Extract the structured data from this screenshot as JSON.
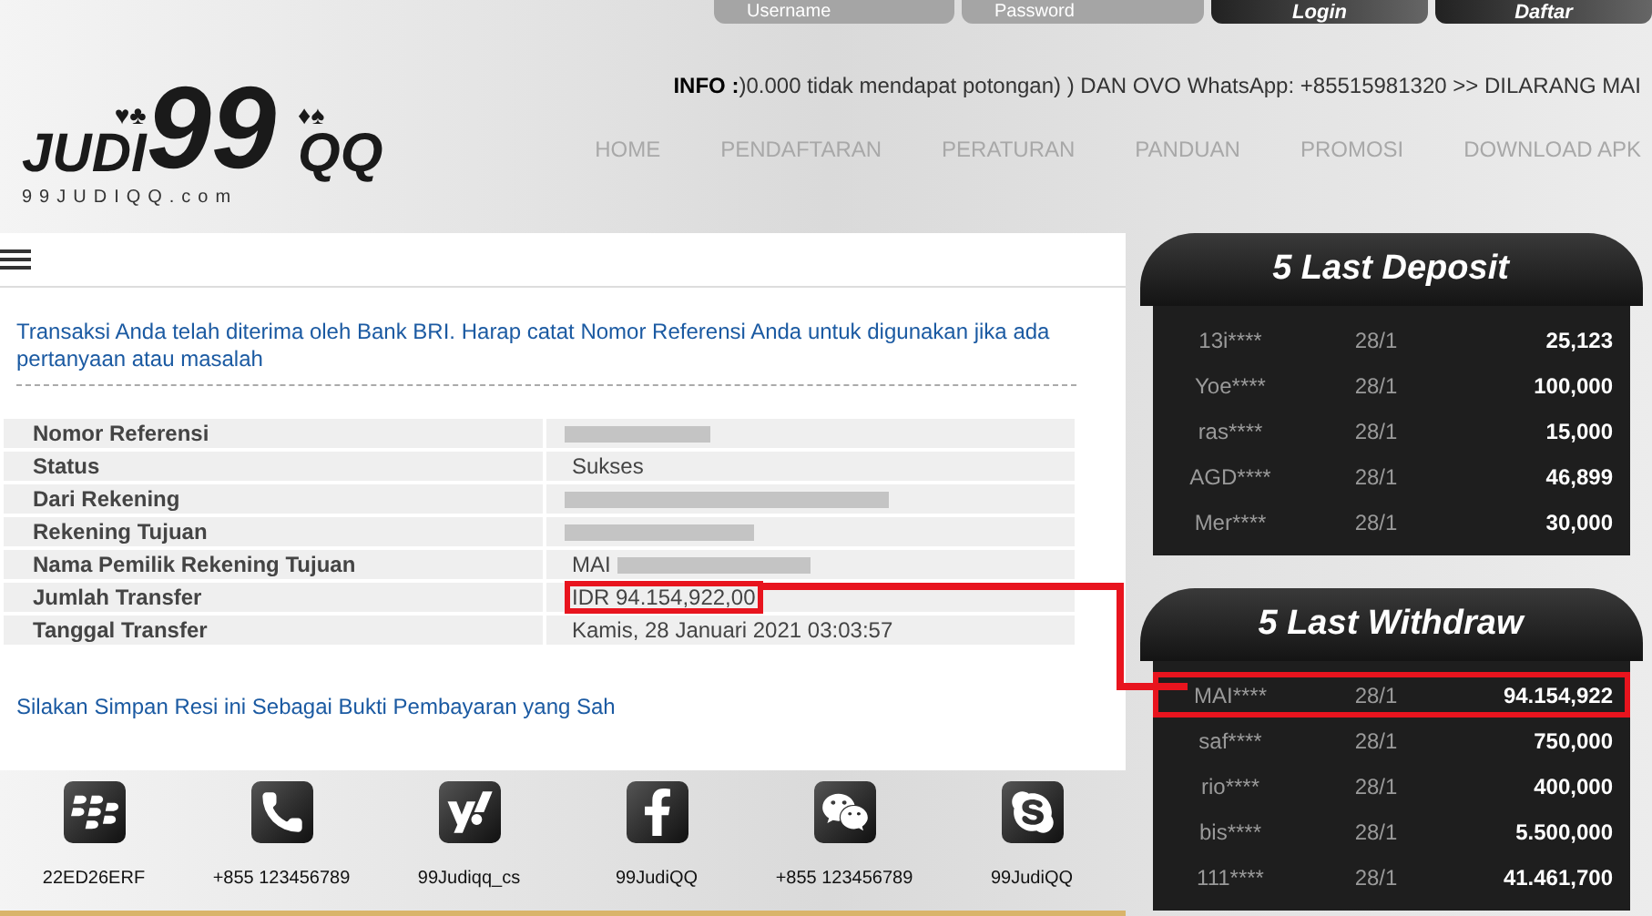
{
  "logo": {
    "numeral": "99",
    "suits_left": "♥♣",
    "suits_right": "♦♠",
    "word_left": "JUDI",
    "word_right": "QQ",
    "domain": "99JUDIQQ.com"
  },
  "login": {
    "username_placeholder": "Username",
    "password_placeholder": "Password",
    "buttons": [
      "Login",
      "Daftar"
    ]
  },
  "info": {
    "label": "INFO :",
    "text": ")0.000 tidak mendapat potongan) ) DAN OVO WhatsApp: +85515981320 >> DILARANG MAI"
  },
  "nav": [
    "HOME",
    "PENDAFTARAN",
    "PERATURAN",
    "PANDUAN",
    "PROMOSI",
    "DOWNLOAD APK"
  ],
  "receipt": {
    "message": "Transaksi Anda telah diterima oleh Bank BRI. Harap catat Nomor Referensi Anda untuk digunakan jika ada pertanyaan atau masalah",
    "rows": [
      {
        "label": "Nomor Referensi",
        "redacted": true
      },
      {
        "label": "Status",
        "value": "Sukses",
        "redacted": false,
        "highlighted": false
      },
      {
        "label": "Dari Rekening",
        "redacted": true
      },
      {
        "label": "Rekening Tujuan",
        "redacted": true
      },
      {
        "label": "Nama Pemilik Rekening Tujuan",
        "value": "MAI",
        "redacted": true,
        "highlighted": false
      },
      {
        "label": "Jumlah Transfer",
        "value": "IDR 94.154,922,00",
        "redacted": false,
        "highlighted": true
      },
      {
        "label": "Tanggal Transfer",
        "value": "Kamis, 28 Januari 2021 03:03:57",
        "redacted": false,
        "highlighted": false
      }
    ],
    "footer_note": "Silakan Simpan Resi ini Sebagai Bukti Pembayaran yang Sah"
  },
  "contacts": [
    {
      "kind": "blackberry",
      "label": "22ED26ERF"
    },
    {
      "kind": "phone",
      "label": "+855 123456789"
    },
    {
      "kind": "yahoo",
      "label": "99Judiqq_cs"
    },
    {
      "kind": "facebook",
      "label": "99JudiQQ"
    },
    {
      "kind": "wechat",
      "label": "+855 123456789"
    },
    {
      "kind": "skype",
      "label": "99JudiQQ"
    }
  ],
  "deposits": {
    "title": "5 Last Deposit",
    "rows": [
      {
        "name": "13i****",
        "date": "28/1",
        "amount": "25,123",
        "highlighted": false
      },
      {
        "name": "Yoe****",
        "date": "28/1",
        "amount": "100,000",
        "highlighted": false
      },
      {
        "name": "ras****",
        "date": "28/1",
        "amount": "15,000",
        "highlighted": false
      },
      {
        "name": "AGD****",
        "date": "28/1",
        "amount": "46,899",
        "highlighted": false
      },
      {
        "name": "Mer****",
        "date": "28/1",
        "amount": "30,000",
        "highlighted": false
      }
    ]
  },
  "withdraws": {
    "title": "5 Last Withdraw",
    "rows": [
      {
        "name": "MAI****",
        "date": "28/1",
        "amount": "94.154,922",
        "highlighted": true
      },
      {
        "name": "saf****",
        "date": "28/1",
        "amount": "750,000",
        "highlighted": false
      },
      {
        "name": "rio****",
        "date": "28/1",
        "amount": "400,000",
        "highlighted": false
      },
      {
        "name": "bis****",
        "date": "28/1",
        "amount": "5.500,000",
        "highlighted": false
      },
      {
        "name": "111****",
        "date": "28/1",
        "amount": "41.461,700",
        "highlighted": false
      }
    ]
  }
}
